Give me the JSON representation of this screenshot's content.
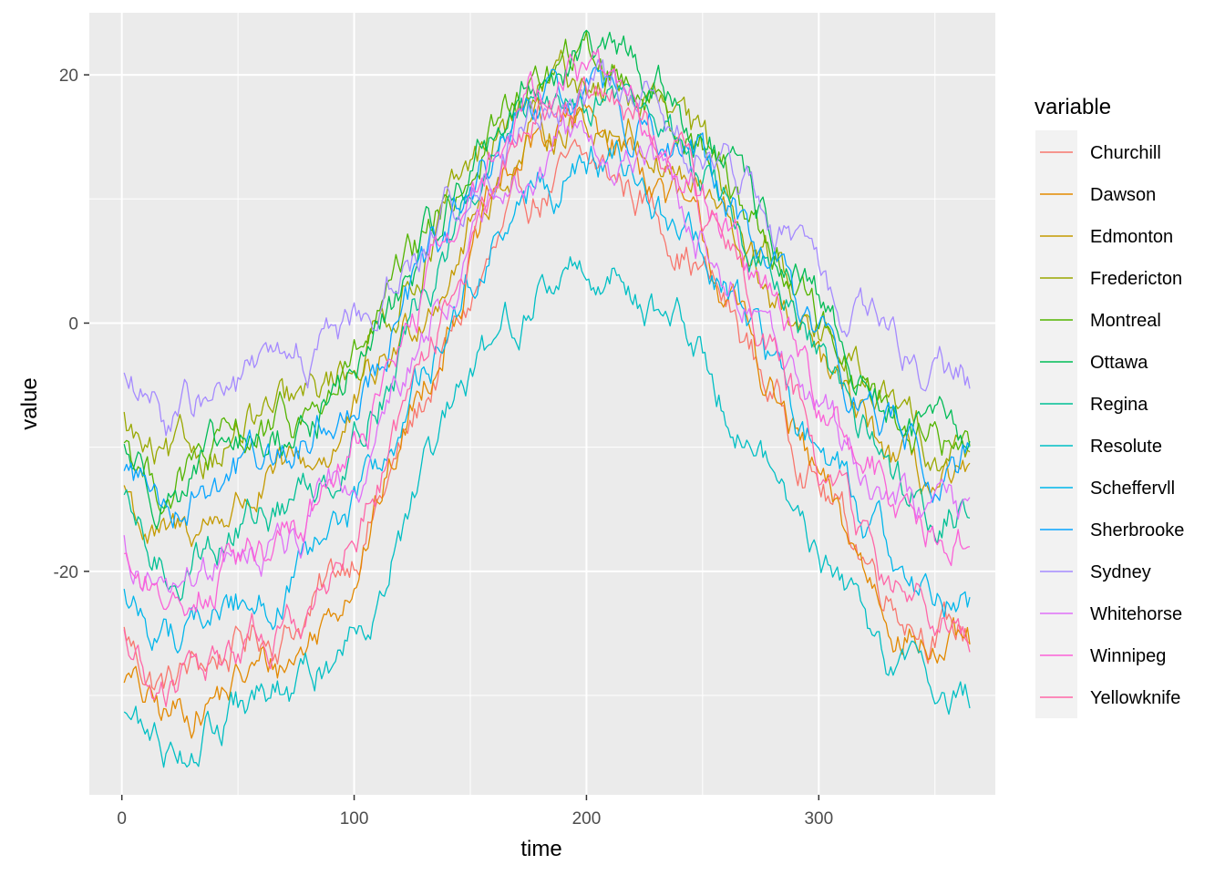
{
  "chart_data": {
    "type": "line",
    "title": "",
    "xlabel": "time",
    "ylabel": "value",
    "xlim": [
      -14,
      376
    ],
    "ylim": [
      -38,
      25
    ],
    "x_ticks": [
      0,
      100,
      200,
      300
    ],
    "x_tick_labels": [
      "0",
      "100",
      "200",
      "300"
    ],
    "y_ticks": [
      20,
      0,
      -20
    ],
    "y_tick_labels": [
      "20",
      "0",
      "-20"
    ],
    "grid": true,
    "background": "#ebebeb",
    "legend": {
      "title": "variable",
      "placement": "right"
    },
    "x_range": [
      1,
      365
    ],
    "series_note": "daily values; each series approximated by start value, peak value near day 200, end value",
    "series": [
      {
        "name": "Churchill",
        "color": "#F8766D",
        "start": -25,
        "peak": 12,
        "peak_day": 200,
        "end": -25,
        "min_early": -29
      },
      {
        "name": "Dawson",
        "color": "#E38900",
        "start": -28,
        "peak": 16,
        "peak_day": 195,
        "end": -27,
        "min_early": -32
      },
      {
        "name": "Edmonton",
        "color": "#C49A00",
        "start": -13,
        "peak": 16.5,
        "peak_day": 200,
        "end": -14,
        "min_early": -18
      },
      {
        "name": "Fredericton",
        "color": "#99A800",
        "start": -8,
        "peak": 19.5,
        "peak_day": 200,
        "end": -10,
        "min_early": -12
      },
      {
        "name": "Montreal",
        "color": "#53B400",
        "start": -9,
        "peak": 21,
        "peak_day": 200,
        "end": -10,
        "min_early": -13
      },
      {
        "name": "Ottawa",
        "color": "#00BC56",
        "start": -10,
        "peak": 21.5,
        "peak_day": 200,
        "end": -10,
        "min_early": -13
      },
      {
        "name": "Regina",
        "color": "#00C094",
        "start": -15,
        "peak": 19,
        "peak_day": 200,
        "end": -15,
        "min_early": -20
      },
      {
        "name": "Resolute",
        "color": "#00BFC4",
        "start": -31,
        "peak": 4.5,
        "peak_day": 200,
        "end": -30,
        "min_early": -34
      },
      {
        "name": "Scheffervll",
        "color": "#00B6EB",
        "start": -22,
        "peak": 12.5,
        "peak_day": 200,
        "end": -22,
        "min_early": -25
      },
      {
        "name": "Sherbrooke",
        "color": "#06A4FF",
        "start": -11,
        "peak": 18,
        "peak_day": 200,
        "end": -11,
        "min_early": -14
      },
      {
        "name": "Sydney",
        "color": "#A58AFF",
        "start": -4,
        "peak": 18,
        "peak_day": 205,
        "end": -4.5,
        "min_early": -8
      },
      {
        "name": "Whitehorse",
        "color": "#DF70F8",
        "start": -18,
        "peak": 14,
        "peak_day": 195,
        "end": -17,
        "min_early": -22
      },
      {
        "name": "Winnipeg",
        "color": "#FB61D7",
        "start": -18,
        "peak": 20,
        "peak_day": 195,
        "end": -17,
        "min_early": -22
      },
      {
        "name": "Yellowknife",
        "color": "#FF66A8",
        "start": -25,
        "peak": 18,
        "peak_day": 200,
        "end": -25,
        "min_early": -30
      }
    ]
  }
}
